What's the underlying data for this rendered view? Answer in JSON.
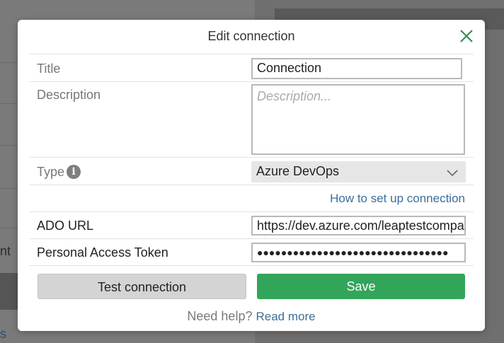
{
  "background": {
    "left_fragment_1": "nt",
    "left_fragment_2": "s"
  },
  "modal": {
    "title": "Edit connection",
    "close_icon": "close-icon",
    "fields": {
      "title": {
        "label": "Title",
        "value": "Connection"
      },
      "description": {
        "label": "Description",
        "placeholder": "Description..."
      },
      "type": {
        "label": "Type",
        "value": "Azure DevOps",
        "info_icon": "info-icon"
      },
      "setup_link": "How to set up connection",
      "ado_url": {
        "label": "ADO URL",
        "value": "https://dev.azure.com/leaptestcompany"
      },
      "token": {
        "label": "Personal Access Token",
        "value": "●●●●●●●●●●●●●●●●●●●●●●●●●●●●●●●●"
      }
    },
    "buttons": {
      "test": "Test connection",
      "save": "Save"
    },
    "help": {
      "text": "Need help?",
      "link": "Read more"
    }
  },
  "colors": {
    "accent_green": "#33a55a",
    "close_green": "#2e8b4e",
    "link_blue": "#3d6e9b"
  }
}
